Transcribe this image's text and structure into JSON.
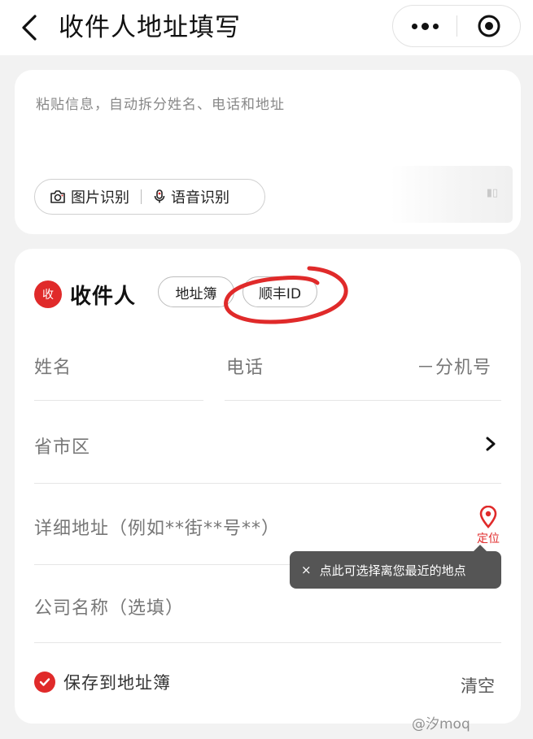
{
  "header": {
    "title": "收件人地址填写"
  },
  "paste_box": {
    "placeholder": "粘贴信息，自动拆分姓名、电话和地址",
    "image_recognition": "图片识别",
    "voice_recognition": "语音识别"
  },
  "receiver": {
    "badge": "收",
    "title": "收件人",
    "address_book_chip": "地址簿",
    "sf_id_chip": "顺丰ID"
  },
  "fields": {
    "name": "姓名",
    "phone": "电话",
    "extension": "－分机号",
    "region": "省市区",
    "address": "详细地址（例如**街**号**）",
    "company": "公司名称（选填）"
  },
  "locate": {
    "label": "定位"
  },
  "tooltip": {
    "close": "×",
    "text": "点此可选择离您最近的地点"
  },
  "footer": {
    "save_label": "保存到地址簿",
    "clear_label": "清空"
  },
  "colors": {
    "accent": "#e02a2a",
    "tooltip_bg": "#555555"
  },
  "watermark": "@汐moq"
}
